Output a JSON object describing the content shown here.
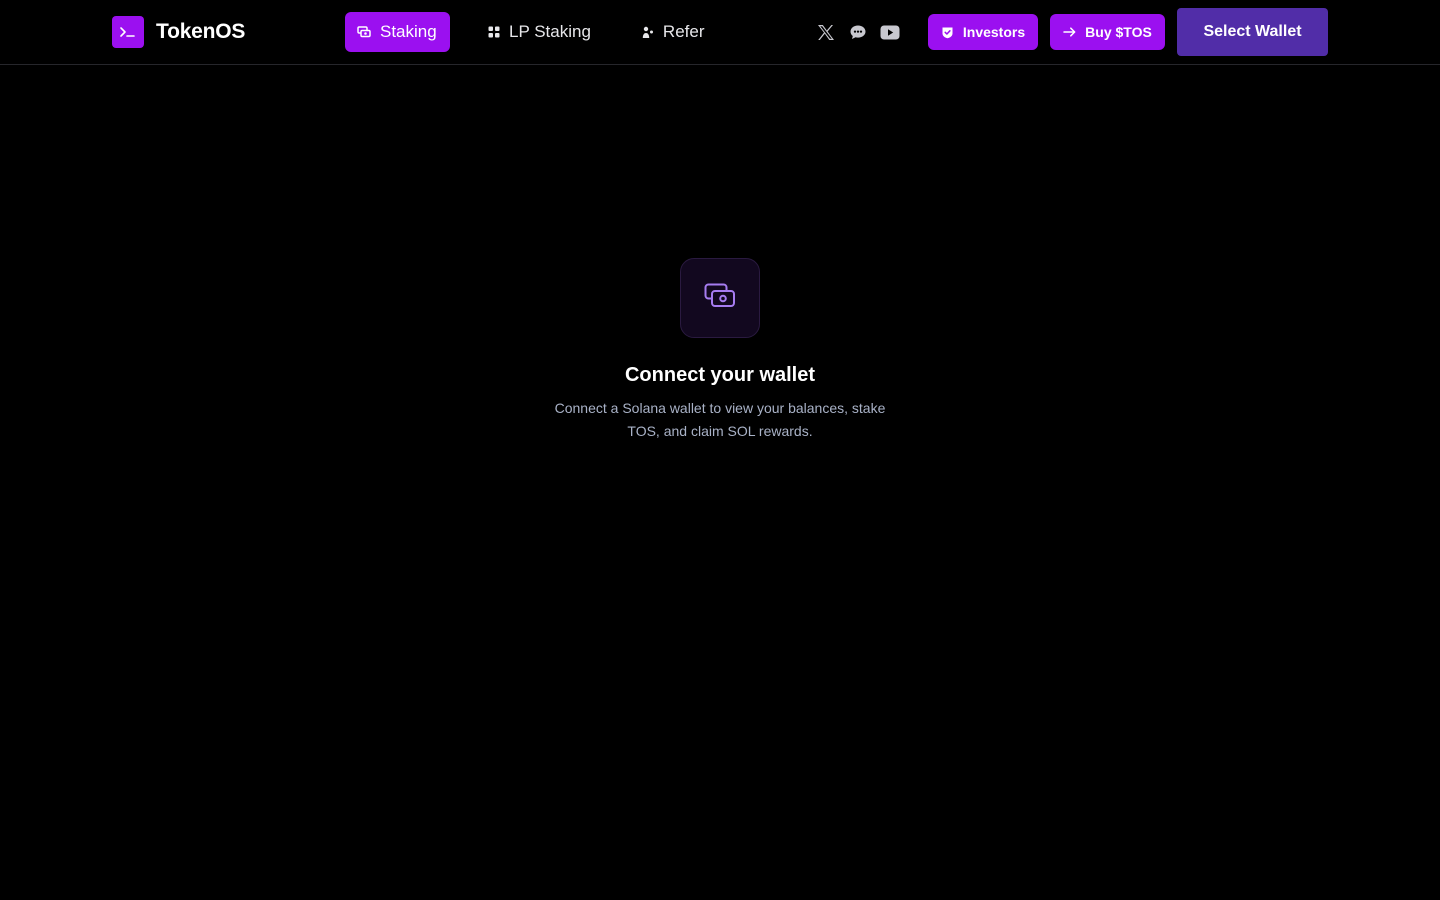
{
  "brand": {
    "name": "TokenOS",
    "logo_glyph": ">_"
  },
  "nav": {
    "items": [
      {
        "label": "Staking",
        "icon": "staking-icon",
        "active": true
      },
      {
        "label": "LP Staking",
        "icon": "grid-icon",
        "active": false
      },
      {
        "label": "Refer",
        "icon": "refer-icon",
        "active": false
      }
    ]
  },
  "socials": [
    "x-icon",
    "chat-icon",
    "youtube-icon"
  ],
  "actions": {
    "investors_label": "Investors",
    "buy_label": "Buy $TOS",
    "wallet_label": "Select Wallet"
  },
  "empty_state": {
    "icon": "wallet-icon",
    "title": "Connect your wallet",
    "description": "Connect a Solana wallet to view your balances, stake TOS, and claim SOL rewards."
  },
  "colors": {
    "accent": "#9b10f0",
    "wallet_button": "#512da8",
    "background": "#000000",
    "muted_text": "#a9b2c7",
    "icon_purple": "#a67cf0"
  }
}
